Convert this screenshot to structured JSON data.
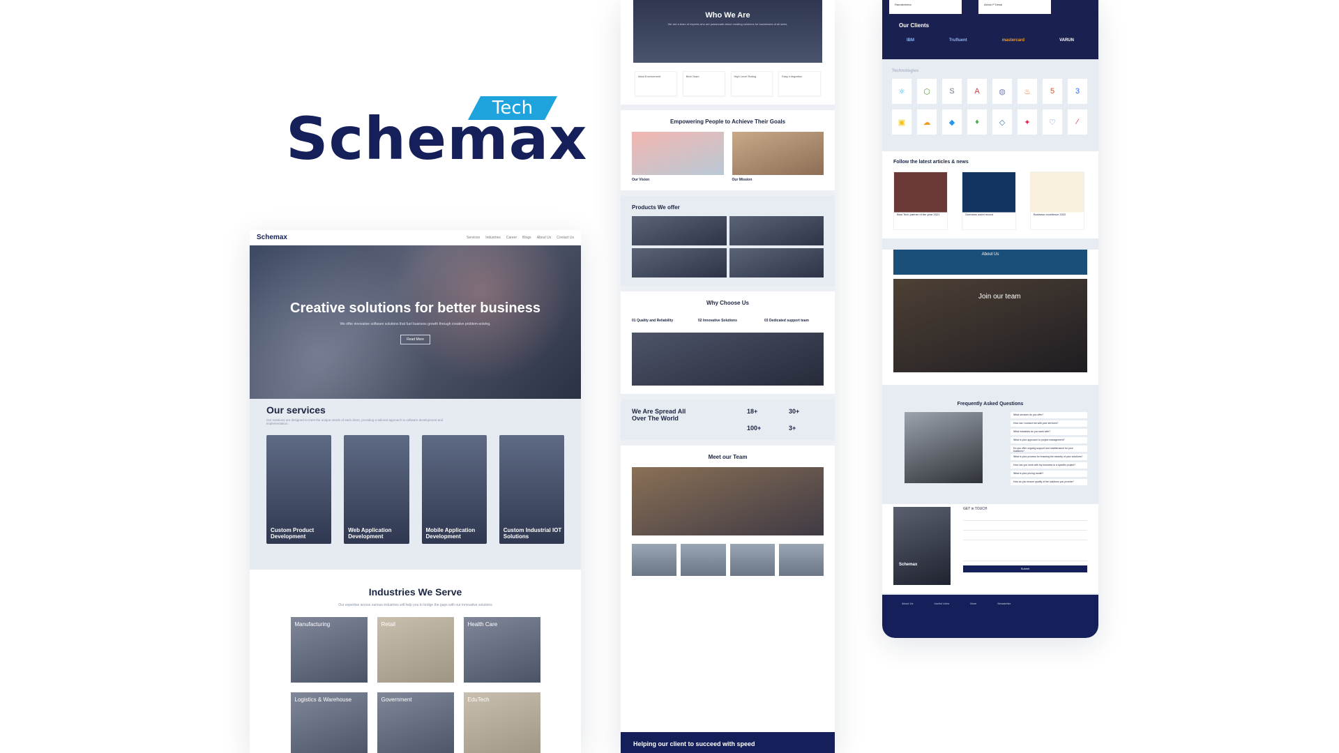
{
  "logo": {
    "word": "Schemax",
    "tag": "Tech"
  },
  "page1": {
    "nav": {
      "brand": "Schemax",
      "links": [
        "Services",
        "Industries",
        "Career",
        "Blogs",
        "About Us",
        "Contact Us"
      ]
    },
    "hero": {
      "title": "Creative solutions for better business",
      "subtitle": "We offer innovative software solutions that fuel business growth through creative problem-solving.",
      "button": "Read More"
    },
    "services": {
      "title": "Our services",
      "text": "Our solutions are designed to meet the unique needs of each client, providing a tailored approach to software development and implementation.",
      "items": [
        "Custom Product Development",
        "Web Application Development",
        "Mobile Application Development",
        "Custom Industrial IOT Solutions"
      ]
    },
    "industries": {
      "title": "Industries We Serve",
      "text": "Our expertise across various industries will help you to bridge the gaps with our innovative solutions",
      "items": [
        "Manufacturing",
        "Retail",
        "Health Care",
        "Logistics & Warehouse",
        "Government",
        "EduTech"
      ]
    }
  },
  "page2": {
    "who": {
      "title": "Who We Are",
      "text": "We are a team of experts who are passionate about creating solutions for businesses of all sizes."
    },
    "features": [
      "Ideal Environment",
      "Best Team",
      "High Level Rating",
      "Easy Integration"
    ],
    "empower": {
      "title": "Empowering People to Achieve Their Goals",
      "vision": "Our Vision",
      "mission": "Our Mission"
    },
    "products": {
      "title": "Products We offer"
    },
    "why": {
      "title": "Why Choose Us",
      "points": [
        "01 Quality and Reliability",
        "02 Innovative Solutions",
        "03 Dedicated support team"
      ]
    },
    "spread": {
      "title": "We Are Spread All Over The World",
      "stats": [
        "18+",
        "30+",
        "100+",
        "3+"
      ]
    },
    "team": {
      "title": "Meet our Team"
    },
    "footer": "Helping our client to succeed with speed"
  },
  "page3": {
    "reviews": [
      "Ramakrishna",
      "Ashok P Desai"
    ],
    "clients": {
      "title": "Our Clients",
      "items": [
        "IBM",
        "Trufluent",
        "mastercard",
        "VARUN"
      ]
    },
    "technologies": {
      "title": "Technologies"
    },
    "news": {
      "title": "Follow the latest articles & news",
      "items": [
        "Best Tech partner of the year 2021",
        "Guinness world record",
        "Business excellence 2022"
      ]
    },
    "about": "About Us",
    "join": "Join our team",
    "faq": {
      "title": "Frequently Asked Questions",
      "items": [
        "What services do you offer?",
        "How can I contact me with your services?",
        "What industries do you work with?",
        "What is your approach to project management?",
        "Do you offer ongoing support and maintenance for your solutions?",
        "What is your process for ensuring the security of your solutions?",
        "How can you work with my business to a specific project?",
        "What is your pricing model?",
        "How do you ensure quality of the solutions you provide?"
      ]
    },
    "contact": {
      "brand": "Schemax",
      "title": "GET in TOUCH",
      "send": "Submit"
    },
    "footer": [
      "About Us",
      "Useful Links",
      "More",
      "Newsletter"
    ]
  }
}
